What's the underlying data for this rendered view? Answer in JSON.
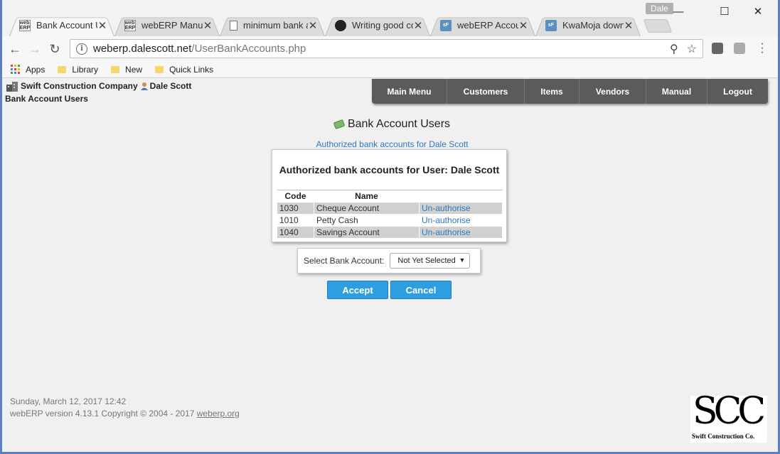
{
  "browser": {
    "tabs": [
      {
        "title": "Bank Account Us",
        "icon": "webERP",
        "active": true
      },
      {
        "title": "webERP Manual",
        "icon": "webERP",
        "active": false
      },
      {
        "title": "minimum bank a",
        "icon": "doc",
        "active": false
      },
      {
        "title": "Writing good co",
        "icon": "github",
        "active": false
      },
      {
        "title": "webERP Account",
        "icon": "sf",
        "active": false
      },
      {
        "title": "KwaMoja downl",
        "icon": "sf",
        "active": false
      }
    ],
    "profile": "Dale",
    "url_host": "weberp.dalescott.net",
    "url_path": "/UserBankAccounts.php",
    "bookmarks": [
      {
        "label": "Apps",
        "type": "apps"
      },
      {
        "label": "Library",
        "type": "folder"
      },
      {
        "label": "New",
        "type": "folder"
      },
      {
        "label": "Quick Links",
        "type": "folder"
      }
    ]
  },
  "header": {
    "company": "Swift Construction Company",
    "user": "Dale Scott",
    "page_title": "Bank Account Users"
  },
  "menu": [
    "Main Menu",
    "Customers",
    "Items",
    "Vendors",
    "Manual",
    "Logout"
  ],
  "main": {
    "title": "Bank Account Users",
    "subtitle": "Authorized bank accounts for Dale Scott",
    "card_title": "Authorized bank accounts for User: Dale Scott",
    "columns": [
      "Code",
      "Name"
    ],
    "rows": [
      {
        "code": "1030",
        "name": "Cheque Account",
        "action": "Un-authorise"
      },
      {
        "code": "1010",
        "name": "Petty Cash",
        "action": "Un-authorise"
      },
      {
        "code": "1040",
        "name": "Savings Account",
        "action": "Un-authorise"
      }
    ],
    "select_label": "Select Bank Account:",
    "select_value": "Not Yet Selected",
    "accept": "Accept",
    "cancel": "Cancel"
  },
  "footer": {
    "datetime": "Sunday, March 12, 2017 12:42",
    "version": "webERP version 4.13.1 Copyright © 2004 - 2017",
    "link": "weberp.org",
    "logo_big": "SCC",
    "logo_small": "Swift Construction Co."
  },
  "colors": {
    "accent": "#2f9ee0",
    "link": "#2a7ac0",
    "menu_bg": "#5b5b5b"
  }
}
